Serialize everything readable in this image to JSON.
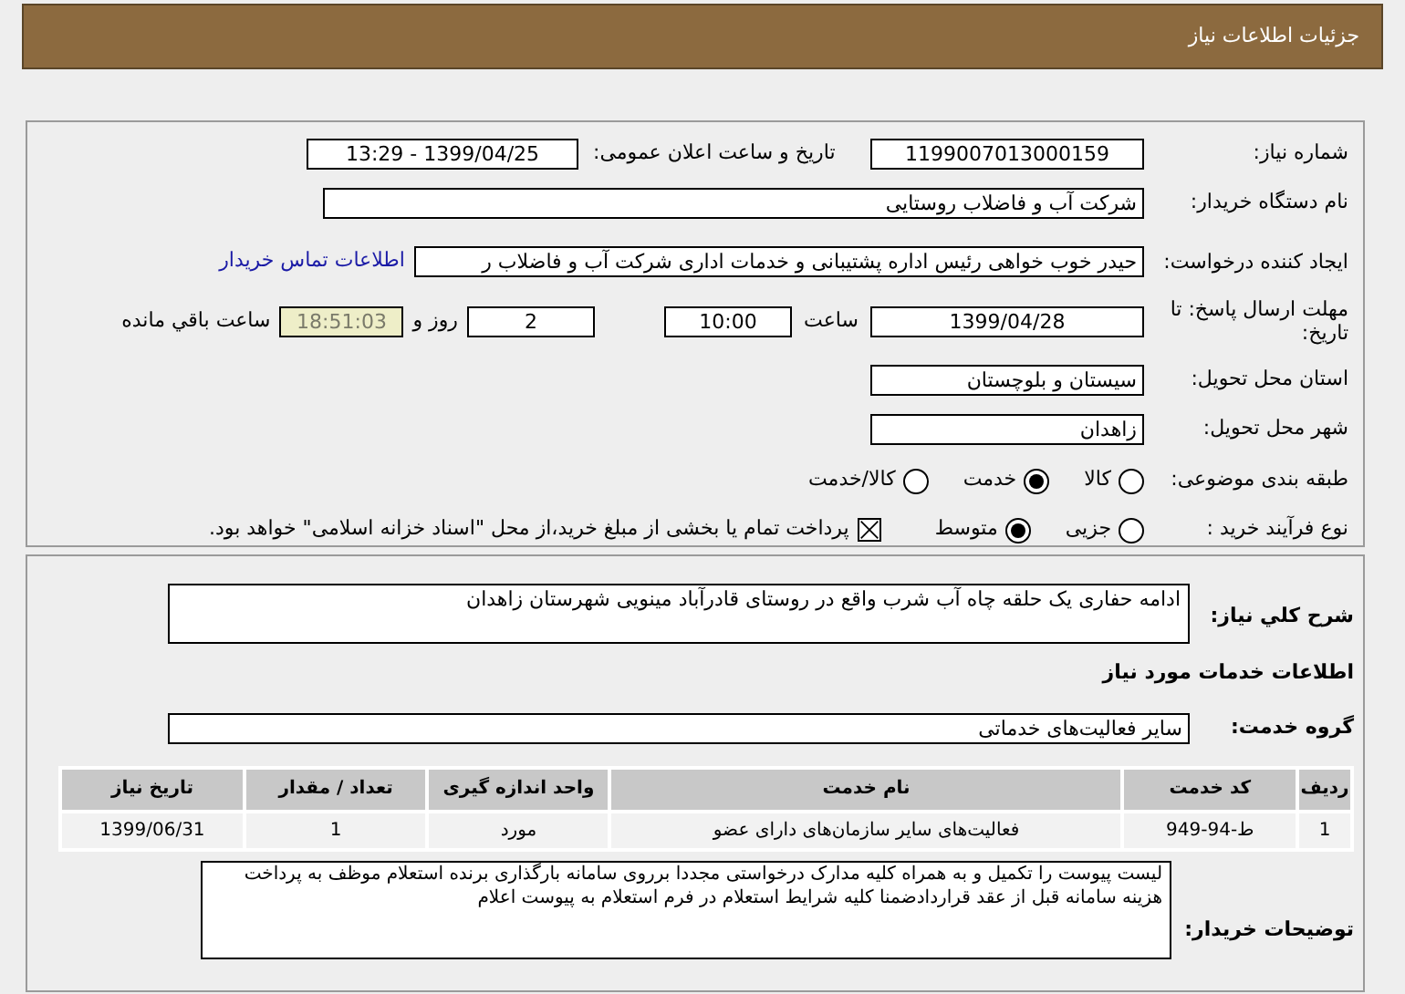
{
  "header": {
    "title": "جزئیات اطلاعات نیاز"
  },
  "need_number": {
    "label": "شماره نیاز:",
    "value": "1199007013000159"
  },
  "announce": {
    "label": "تاریخ و ساعت اعلان عمومی:",
    "value": "1399/04/25 - 13:29"
  },
  "buyer": {
    "label": "نام دستگاه خریدار:",
    "value": "شرکت آب و فاضلاب روستایی"
  },
  "creator": {
    "label": "ایجاد کننده درخواست:",
    "value": "حیدر خوب خواهی  رئیس اداره پشتیبانی و خدمات اداری  شرکت آب و فاضلاب ر",
    "link": "اطلاعات تماس خریدار"
  },
  "deadline": {
    "label": "مهلت ارسال پاسخ: تا تاریخ:",
    "date": "1399/04/28",
    "time_label": "ساعت",
    "time": "10:00",
    "days": "2",
    "days_label": "روز و",
    "remaining": "18:51:03",
    "remaining_label": "ساعت باقي مانده"
  },
  "province": {
    "label": "استان محل تحویل:",
    "value": "سیستان و بلوچستان"
  },
  "city": {
    "label": "شهر محل تحویل:",
    "value": "زاهدان"
  },
  "category": {
    "label": "طبقه بندی موضوعی:",
    "options": [
      {
        "label": "کالا",
        "selected": false
      },
      {
        "label": "خدمت",
        "selected": true
      },
      {
        "label": "کالا/خدمت",
        "selected": false
      }
    ]
  },
  "process": {
    "label": "نوع فرآیند خرید :",
    "options": [
      {
        "label": "جزیی",
        "selected": false
      },
      {
        "label": "متوسط",
        "selected": true
      }
    ],
    "payment": {
      "checked": true,
      "text": "پرداخت تمام یا بخشی از مبلغ خرید،از محل \"اسناد خزانه اسلامی\" خواهد بود."
    }
  },
  "description": {
    "label": "شرح كلي نياز:",
    "value": "ادامه حفاری یک حلقه چاه آب شرب واقع در روستای قادرآباد مینویی شهرستان زاهدان"
  },
  "services_title": "اطلاعات خدمات مورد نیاز",
  "service_group": {
    "label": "گروه خدمت:",
    "value": "سایر فعالیت‌های خدماتی"
  },
  "table": {
    "columns": [
      "ردیف",
      "کد خدمت",
      "نام خدمت",
      "واحد اندازه گیری",
      "تعداد / مقدار",
      "تاریخ نیاز"
    ],
    "rows": [
      [
        "1",
        "ط-94-949",
        "فعالیت‌های سایر سازمان‌های دارای عضو",
        "مورد",
        "1",
        "1399/06/31"
      ]
    ]
  },
  "buyer_notes": {
    "label": "توضیحات خریدار:",
    "value": "لیست پیوست را تکمیل و به همراه کلیه مدارک درخواستی مجددا برروی سامانه بارگذاری برنده استعلام موظف به پرداخت هزینه سامانه قبل از عقد قراردادضمنا کلیه شرایط استعلام در فرم استعلام به پیوست اعلام"
  }
}
